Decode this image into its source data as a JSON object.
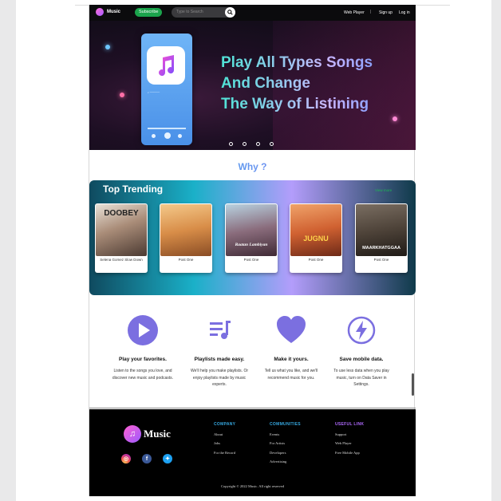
{
  "navbar": {
    "logo_text": "Music",
    "subscribe_label": "Subscribe",
    "search_placeholder": "Type to Search",
    "links": [
      "Web Player",
      "|",
      "Sign up",
      "Log in"
    ]
  },
  "hero": {
    "title_lines": [
      "Play All Types Songs",
      "And Change",
      "The Way of Listining"
    ]
  },
  "why": {
    "heading": "Why ?"
  },
  "trending": {
    "title": "Top Trending",
    "view_more": "View more",
    "cards": [
      {
        "image_text": "DOOBEY",
        "label": "Selena Gomez Slow Down",
        "bg": "#6b4b3a"
      },
      {
        "image_text": "",
        "label": "Post One",
        "bg": "#c97d3f"
      },
      {
        "image_text": "Raatan Lambiyan",
        "label": "Post One",
        "bg": "#7a4e61"
      },
      {
        "image_text": "JUGNU",
        "label": "Post One",
        "bg": "#c7572a"
      },
      {
        "image_text": "MAARKHATGGAA",
        "label": "Post One",
        "bg": "#4b4138"
      }
    ]
  },
  "features": [
    {
      "title": "Play your favorites.",
      "desc": "Listen to the songs you love, and discover new music and podcasts."
    },
    {
      "title": "Playlists made easy.",
      "desc": "We'll help you make playlists. Or enjoy playlists made by music experts."
    },
    {
      "title": "Make it yours.",
      "desc": "Tell us what you like, and we'll recommend music for you."
    },
    {
      "title": "Save mobile data.",
      "desc": "To use less data when you play music, turn on Data Saver in Settings."
    }
  ],
  "footer": {
    "logo_text": "Music",
    "columns": [
      {
        "title": "COMPANY",
        "color": "#36a8e0",
        "items": [
          "About",
          "Jobs",
          "For the Record"
        ]
      },
      {
        "title": "COMMUNITIES",
        "color": "#36a8e0",
        "items": [
          "Events",
          "For Artists",
          "Developers",
          "Advertising"
        ]
      },
      {
        "title": "USEFUL LINK",
        "color": "#b06bff",
        "items": [
          "Support",
          "Web Player",
          "Free Mobile App"
        ]
      }
    ],
    "copyright": "Copyright © 2022 Music. All right reserved"
  },
  "colors": {
    "accent": "#7b6fe0",
    "brand_green": "#1ba44c"
  }
}
